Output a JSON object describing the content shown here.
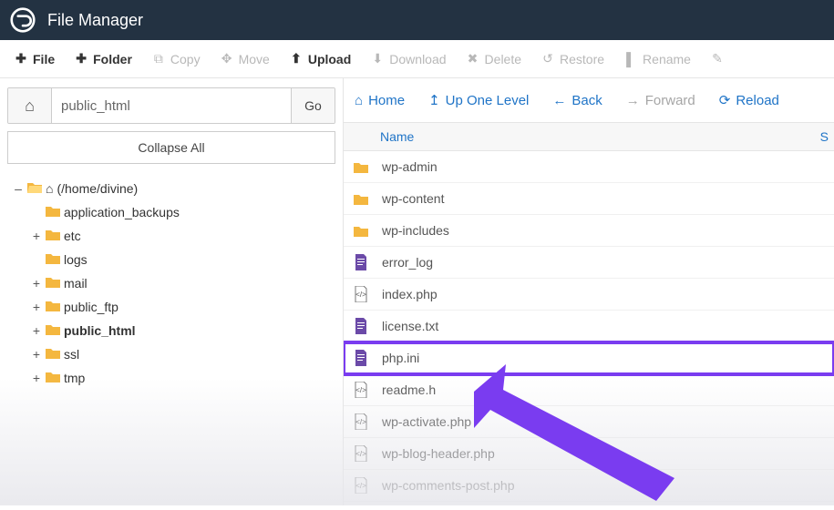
{
  "app": {
    "title": "File Manager"
  },
  "toolbar": {
    "file": "File",
    "folder": "Folder",
    "copy": "Copy",
    "move": "Move",
    "upload": "Upload",
    "download": "Download",
    "delete": "Delete",
    "restore": "Restore",
    "rename": "Rename"
  },
  "path": {
    "value": "public_html",
    "go": "Go"
  },
  "collapse": "Collapse All",
  "tree": {
    "root": "(/home/divine)",
    "items": [
      {
        "expand": "",
        "label": "application_backups",
        "bold": false
      },
      {
        "expand": "+",
        "label": "etc",
        "bold": false
      },
      {
        "expand": "",
        "label": "logs",
        "bold": false
      },
      {
        "expand": "+",
        "label": "mail",
        "bold": false
      },
      {
        "expand": "+",
        "label": "public_ftp",
        "bold": false
      },
      {
        "expand": "+",
        "label": "public_html",
        "bold": true
      },
      {
        "expand": "+",
        "label": "ssl",
        "bold": false
      },
      {
        "expand": "+",
        "label": "tmp",
        "bold": false
      }
    ]
  },
  "nav": {
    "home": "Home",
    "up": "Up One Level",
    "back": "Back",
    "forward": "Forward",
    "reload": "Reload"
  },
  "columns": {
    "name": "Name",
    "size": "S"
  },
  "files": [
    {
      "type": "folder",
      "name": "wp-admin"
    },
    {
      "type": "folder",
      "name": "wp-content"
    },
    {
      "type": "folder",
      "name": "wp-includes"
    },
    {
      "type": "doc",
      "name": "error_log"
    },
    {
      "type": "code",
      "name": "index.php"
    },
    {
      "type": "doc",
      "name": "license.txt"
    },
    {
      "type": "doc",
      "name": "php.ini",
      "highlight": true
    },
    {
      "type": "code",
      "name": "readme.h"
    },
    {
      "type": "code",
      "name": "wp-activate.php"
    },
    {
      "type": "code",
      "name": "wp-blog-header.php"
    },
    {
      "type": "code",
      "name": "wp-comments-post.php"
    }
  ]
}
